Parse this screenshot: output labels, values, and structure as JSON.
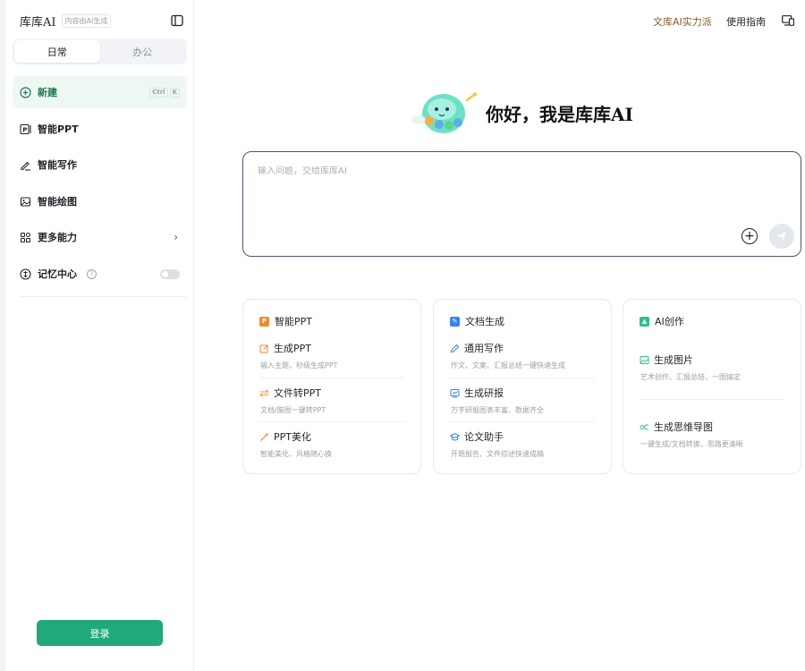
{
  "brand": {
    "name": "库库AI",
    "tag": "内容由AI生成"
  },
  "mode_tabs": [
    {
      "label": "日常",
      "active": true
    },
    {
      "label": "办公",
      "active": false
    }
  ],
  "nav": {
    "new": {
      "label": "新建",
      "shortcut": [
        "Ctrl",
        "K"
      ]
    },
    "ppt": {
      "label": "智能PPT"
    },
    "write": {
      "label": "智能写作"
    },
    "draw": {
      "label": "智能绘图"
    },
    "more": {
      "label": "更多能力"
    },
    "memory": {
      "label": "记忆中心",
      "help": "?"
    }
  },
  "login": {
    "label": "登录"
  },
  "topbar": {
    "promo": "文库AI实力派",
    "guide": "使用指南"
  },
  "greeting": "你好，我是库库AI",
  "chat": {
    "placeholder": "输入问题，交给库库AI",
    "plus": "+"
  },
  "cards": {
    "ppt": {
      "title": "智能PPT",
      "items": [
        {
          "title": "生成PPT",
          "desc": "输入主题，秒级生成PPT"
        },
        {
          "title": "文件转PPT",
          "desc": "文档/脑图一键转PPT"
        },
        {
          "title": "PPT美化",
          "desc": "智能美化，风格随心换"
        }
      ]
    },
    "doc": {
      "title": "文档生成",
      "items": [
        {
          "title": "通用写作",
          "desc": "作文、文案、汇报总结一键快速生成"
        },
        {
          "title": "生成研报",
          "desc": "万字研报图表丰富、数据齐全"
        },
        {
          "title": "论文助手",
          "desc": "开题报告、文件综述快速成稿"
        }
      ]
    },
    "ai": {
      "title": "AI创作",
      "items": [
        {
          "title": "生成图片",
          "desc": "艺术创作、汇报总结，一图搞定"
        },
        {
          "title": "生成思维导图",
          "desc": "一键生成/文档转换，思路更清晰"
        }
      ]
    }
  },
  "colors": {
    "accent": "#22a97a",
    "active_bg": "#eef8f3",
    "promo": "#8a5a2b",
    "ppt_badge": "#f0892e",
    "doc_badge": "#3b82f6",
    "ai_badge": "#2fbf8f"
  }
}
